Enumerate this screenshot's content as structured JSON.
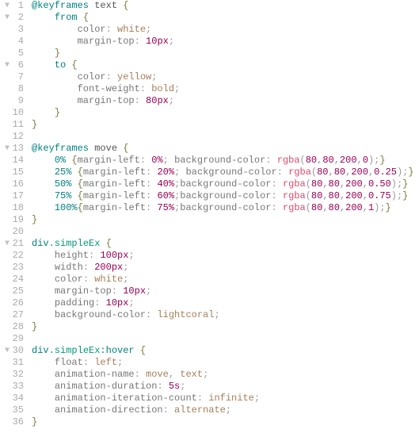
{
  "lines": [
    {
      "n": 1,
      "fold": true,
      "tokens": [
        [
          "@keyframes",
          "atrule"
        ],
        [
          " text ",
          "default"
        ],
        [
          "{",
          "brace"
        ]
      ]
    },
    {
      "n": 2,
      "fold": true,
      "tokens": [
        [
          "    ",
          "default"
        ],
        [
          "from",
          "selector"
        ],
        [
          " ",
          "default"
        ],
        [
          "{",
          "brace"
        ]
      ]
    },
    {
      "n": 3,
      "fold": false,
      "tokens": [
        [
          "        ",
          "default"
        ],
        [
          "color",
          "prop"
        ],
        [
          ": ",
          "punc"
        ],
        [
          "white",
          "colorword"
        ],
        [
          ";",
          "punc"
        ]
      ]
    },
    {
      "n": 4,
      "fold": false,
      "tokens": [
        [
          "        ",
          "default"
        ],
        [
          "margin-top",
          "prop"
        ],
        [
          ": ",
          "punc"
        ],
        [
          "10",
          "number"
        ],
        [
          "px",
          "unit"
        ],
        [
          ";",
          "punc"
        ]
      ]
    },
    {
      "n": 5,
      "fold": false,
      "tokens": [
        [
          "    ",
          "default"
        ],
        [
          "}",
          "brace"
        ]
      ]
    },
    {
      "n": 6,
      "fold": true,
      "tokens": [
        [
          "    ",
          "default"
        ],
        [
          "to",
          "selector"
        ],
        [
          " ",
          "default"
        ],
        [
          "{",
          "brace"
        ]
      ]
    },
    {
      "n": 7,
      "fold": false,
      "tokens": [
        [
          "        ",
          "default"
        ],
        [
          "color",
          "prop"
        ],
        [
          ": ",
          "punc"
        ],
        [
          "yellow",
          "colorword"
        ],
        [
          ";",
          "punc"
        ]
      ]
    },
    {
      "n": 8,
      "fold": false,
      "tokens": [
        [
          "        ",
          "default"
        ],
        [
          "font-weight",
          "prop"
        ],
        [
          ": ",
          "punc"
        ],
        [
          "bold",
          "value"
        ],
        [
          ";",
          "punc"
        ]
      ]
    },
    {
      "n": 9,
      "fold": false,
      "tokens": [
        [
          "        ",
          "default"
        ],
        [
          "margin-top",
          "prop"
        ],
        [
          ": ",
          "punc"
        ],
        [
          "80",
          "number"
        ],
        [
          "px",
          "unit"
        ],
        [
          ";",
          "punc"
        ]
      ]
    },
    {
      "n": 10,
      "fold": false,
      "tokens": [
        [
          "    ",
          "default"
        ],
        [
          "}",
          "brace"
        ]
      ]
    },
    {
      "n": 11,
      "fold": false,
      "tokens": [
        [
          "}",
          "brace"
        ]
      ]
    },
    {
      "n": 12,
      "fold": false,
      "tokens": []
    },
    {
      "n": 13,
      "fold": true,
      "tokens": [
        [
          "@keyframes",
          "atrule"
        ],
        [
          " move ",
          "default"
        ],
        [
          "{",
          "brace"
        ]
      ]
    },
    {
      "n": 14,
      "fold": false,
      "tokens": [
        [
          "    ",
          "default"
        ],
        [
          "0%",
          "selector"
        ],
        [
          " ",
          "default"
        ],
        [
          "{",
          "brace"
        ],
        [
          "margin-left",
          "prop"
        ],
        [
          ": ",
          "punc"
        ],
        [
          "0",
          "number"
        ],
        [
          "%",
          "unit"
        ],
        [
          ";",
          "punc"
        ],
        [
          " ",
          "default"
        ],
        [
          "background-color",
          "prop"
        ],
        [
          ": ",
          "punc"
        ],
        [
          "rgba",
          "func"
        ],
        [
          "(",
          "punc"
        ],
        [
          "80",
          "number"
        ],
        [
          ",",
          "punc"
        ],
        [
          "80",
          "number"
        ],
        [
          ",",
          "punc"
        ],
        [
          "200",
          "number"
        ],
        [
          ",",
          "punc"
        ],
        [
          "0",
          "number"
        ],
        [
          ")",
          "punc"
        ],
        [
          ";",
          "punc"
        ],
        [
          "}",
          "brace"
        ]
      ]
    },
    {
      "n": 15,
      "fold": false,
      "tokens": [
        [
          "    ",
          "default"
        ],
        [
          "25%",
          "selector"
        ],
        [
          " ",
          "default"
        ],
        [
          "{",
          "brace"
        ],
        [
          "margin-left",
          "prop"
        ],
        [
          ": ",
          "punc"
        ],
        [
          "20",
          "number"
        ],
        [
          "%",
          "unit"
        ],
        [
          ";",
          "punc"
        ],
        [
          " ",
          "default"
        ],
        [
          "background-color",
          "prop"
        ],
        [
          ": ",
          "punc"
        ],
        [
          "rgba",
          "func"
        ],
        [
          "(",
          "punc"
        ],
        [
          "80",
          "number"
        ],
        [
          ",",
          "punc"
        ],
        [
          "80",
          "number"
        ],
        [
          ",",
          "punc"
        ],
        [
          "200",
          "number"
        ],
        [
          ",",
          "punc"
        ],
        [
          "0.25",
          "number"
        ],
        [
          ")",
          "punc"
        ],
        [
          ";",
          "punc"
        ],
        [
          "}",
          "brace"
        ]
      ]
    },
    {
      "n": 16,
      "fold": false,
      "tokens": [
        [
          "    ",
          "default"
        ],
        [
          "50%",
          "selector"
        ],
        [
          " ",
          "default"
        ],
        [
          "{",
          "brace"
        ],
        [
          "margin-left",
          "prop"
        ],
        [
          ": ",
          "punc"
        ],
        [
          "40",
          "number"
        ],
        [
          "%",
          "unit"
        ],
        [
          ";",
          "punc"
        ],
        [
          "background-color",
          "prop"
        ],
        [
          ": ",
          "punc"
        ],
        [
          "rgba",
          "func"
        ],
        [
          "(",
          "punc"
        ],
        [
          "80",
          "number"
        ],
        [
          ",",
          "punc"
        ],
        [
          "80",
          "number"
        ],
        [
          ",",
          "punc"
        ],
        [
          "200",
          "number"
        ],
        [
          ",",
          "punc"
        ],
        [
          "0.50",
          "number"
        ],
        [
          ")",
          "punc"
        ],
        [
          ";",
          "punc"
        ],
        [
          "}",
          "brace"
        ]
      ]
    },
    {
      "n": 17,
      "fold": false,
      "tokens": [
        [
          "    ",
          "default"
        ],
        [
          "75%",
          "selector"
        ],
        [
          " ",
          "default"
        ],
        [
          "{",
          "brace"
        ],
        [
          "margin-left",
          "prop"
        ],
        [
          ": ",
          "punc"
        ],
        [
          "60",
          "number"
        ],
        [
          "%",
          "unit"
        ],
        [
          ";",
          "punc"
        ],
        [
          "background-color",
          "prop"
        ],
        [
          ": ",
          "punc"
        ],
        [
          "rgba",
          "func"
        ],
        [
          "(",
          "punc"
        ],
        [
          "80",
          "number"
        ],
        [
          ",",
          "punc"
        ],
        [
          "80",
          "number"
        ],
        [
          ",",
          "punc"
        ],
        [
          "200",
          "number"
        ],
        [
          ",",
          "punc"
        ],
        [
          "0.75",
          "number"
        ],
        [
          ")",
          "punc"
        ],
        [
          ";",
          "punc"
        ],
        [
          "}",
          "brace"
        ]
      ]
    },
    {
      "n": 18,
      "fold": false,
      "tokens": [
        [
          "    ",
          "default"
        ],
        [
          "100%",
          "selector"
        ],
        [
          "{",
          "brace"
        ],
        [
          "margin-left",
          "prop"
        ],
        [
          ": ",
          "punc"
        ],
        [
          "75",
          "number"
        ],
        [
          "%",
          "unit"
        ],
        [
          ";",
          "punc"
        ],
        [
          "background-color",
          "prop"
        ],
        [
          ": ",
          "punc"
        ],
        [
          "rgba",
          "func"
        ],
        [
          "(",
          "punc"
        ],
        [
          "80",
          "number"
        ],
        [
          ",",
          "punc"
        ],
        [
          "80",
          "number"
        ],
        [
          ",",
          "punc"
        ],
        [
          "200",
          "number"
        ],
        [
          ",",
          "punc"
        ],
        [
          "1",
          "number"
        ],
        [
          ")",
          "punc"
        ],
        [
          ";",
          "punc"
        ],
        [
          "}",
          "brace"
        ]
      ]
    },
    {
      "n": 19,
      "fold": false,
      "tokens": [
        [
          "}",
          "brace"
        ]
      ]
    },
    {
      "n": 20,
      "fold": false,
      "tokens": []
    },
    {
      "n": 21,
      "fold": true,
      "tokens": [
        [
          "div",
          "selector"
        ],
        [
          ".simpleEx",
          "classname"
        ],
        [
          " ",
          "default"
        ],
        [
          "{",
          "brace"
        ]
      ]
    },
    {
      "n": 22,
      "fold": false,
      "tokens": [
        [
          "    ",
          "default"
        ],
        [
          "height",
          "prop"
        ],
        [
          ": ",
          "punc"
        ],
        [
          "100",
          "number"
        ],
        [
          "px",
          "unit"
        ],
        [
          ";",
          "punc"
        ]
      ]
    },
    {
      "n": 23,
      "fold": false,
      "tokens": [
        [
          "    ",
          "default"
        ],
        [
          "width",
          "prop"
        ],
        [
          ": ",
          "punc"
        ],
        [
          "200",
          "number"
        ],
        [
          "px",
          "unit"
        ],
        [
          ";",
          "punc"
        ]
      ]
    },
    {
      "n": 24,
      "fold": false,
      "tokens": [
        [
          "    ",
          "default"
        ],
        [
          "color",
          "prop"
        ],
        [
          ": ",
          "punc"
        ],
        [
          "white",
          "colorword"
        ],
        [
          ";",
          "punc"
        ]
      ]
    },
    {
      "n": 25,
      "fold": false,
      "tokens": [
        [
          "    ",
          "default"
        ],
        [
          "margin-top",
          "prop"
        ],
        [
          ": ",
          "punc"
        ],
        [
          "10",
          "number"
        ],
        [
          "px",
          "unit"
        ],
        [
          ";",
          "punc"
        ]
      ]
    },
    {
      "n": 26,
      "fold": false,
      "tokens": [
        [
          "    ",
          "default"
        ],
        [
          "padding",
          "prop"
        ],
        [
          ": ",
          "punc"
        ],
        [
          "10",
          "number"
        ],
        [
          "px",
          "unit"
        ],
        [
          ";",
          "punc"
        ]
      ]
    },
    {
      "n": 27,
      "fold": false,
      "tokens": [
        [
          "    ",
          "default"
        ],
        [
          "background-color",
          "prop"
        ],
        [
          ": ",
          "punc"
        ],
        [
          "lightcoral",
          "colorword"
        ],
        [
          ";",
          "punc"
        ]
      ]
    },
    {
      "n": 28,
      "fold": false,
      "tokens": [
        [
          "}",
          "brace"
        ]
      ]
    },
    {
      "n": 29,
      "fold": false,
      "tokens": []
    },
    {
      "n": 30,
      "fold": true,
      "tokens": [
        [
          "div",
          "selector"
        ],
        [
          ".simpleEx",
          "classname"
        ],
        [
          ":hover",
          "selector"
        ],
        [
          " ",
          "default"
        ],
        [
          "{",
          "brace"
        ]
      ]
    },
    {
      "n": 31,
      "fold": false,
      "tokens": [
        [
          "    ",
          "default"
        ],
        [
          "float",
          "prop"
        ],
        [
          ": ",
          "punc"
        ],
        [
          "left",
          "value"
        ],
        [
          ";",
          "punc"
        ]
      ]
    },
    {
      "n": 32,
      "fold": false,
      "tokens": [
        [
          "    ",
          "default"
        ],
        [
          "animation-name",
          "prop"
        ],
        [
          ": ",
          "punc"
        ],
        [
          "move",
          "value"
        ],
        [
          ", ",
          "punc"
        ],
        [
          "text",
          "value"
        ],
        [
          ";",
          "punc"
        ]
      ]
    },
    {
      "n": 33,
      "fold": false,
      "tokens": [
        [
          "    ",
          "default"
        ],
        [
          "animation-duration",
          "prop"
        ],
        [
          ": ",
          "punc"
        ],
        [
          "5",
          "number"
        ],
        [
          "s",
          "unit"
        ],
        [
          ";",
          "punc"
        ]
      ]
    },
    {
      "n": 34,
      "fold": false,
      "tokens": [
        [
          "    ",
          "default"
        ],
        [
          "animation-iteration-count",
          "prop"
        ],
        [
          ": ",
          "punc"
        ],
        [
          "infinite",
          "value"
        ],
        [
          ";",
          "punc"
        ]
      ]
    },
    {
      "n": 35,
      "fold": false,
      "tokens": [
        [
          "    ",
          "default"
        ],
        [
          "animation-direction",
          "prop"
        ],
        [
          ": ",
          "punc"
        ],
        [
          "alternate",
          "value"
        ],
        [
          ";",
          "punc"
        ]
      ]
    },
    {
      "n": 36,
      "fold": false,
      "tokens": [
        [
          "}",
          "brace"
        ]
      ]
    }
  ]
}
